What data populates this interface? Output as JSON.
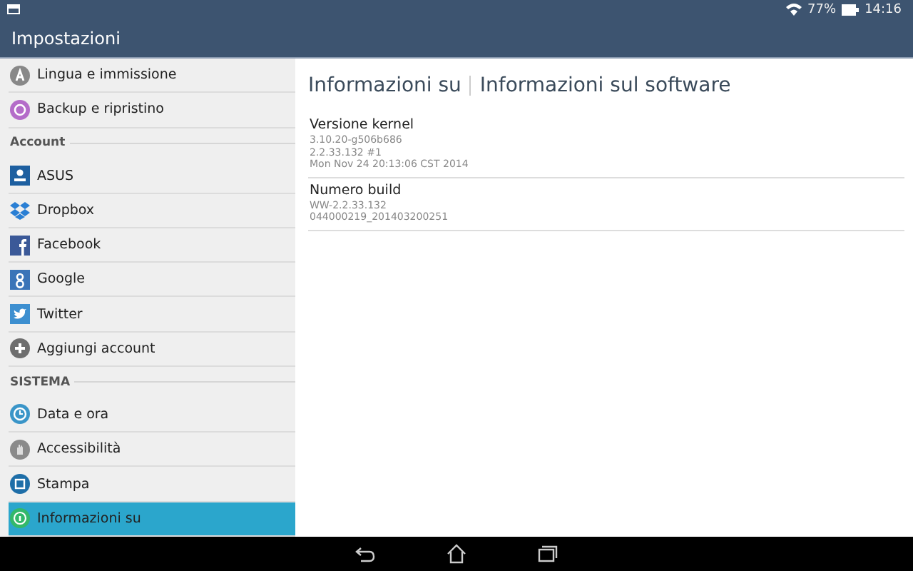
{
  "status_bar": {
    "battery": "77%",
    "time": "14:16"
  },
  "action_bar": {
    "title": "Impostazioni"
  },
  "sidebar": {
    "items": [
      {
        "kind": "item",
        "label": "Lingua e immissione",
        "selected": false
      },
      {
        "kind": "item",
        "label": "Backup e ripristino",
        "selected": false
      },
      {
        "kind": "header",
        "label": "Account"
      },
      {
        "kind": "item",
        "label": "ASUS",
        "selected": false
      },
      {
        "kind": "item",
        "label": "Dropbox",
        "selected": false
      },
      {
        "kind": "item",
        "label": "Facebook",
        "selected": false
      },
      {
        "kind": "item",
        "label": "Google",
        "selected": false
      },
      {
        "kind": "item",
        "label": "Twitter",
        "selected": false
      },
      {
        "kind": "item",
        "label": "Aggiungi account",
        "selected": false
      },
      {
        "kind": "header",
        "label": "SISTEMA"
      },
      {
        "kind": "item",
        "label": "Data e ora",
        "selected": false
      },
      {
        "kind": "item",
        "label": "Accessibilità",
        "selected": false
      },
      {
        "kind": "item",
        "label": "Stampa",
        "selected": false
      },
      {
        "kind": "item",
        "label": "Informazioni su",
        "selected": true
      }
    ]
  },
  "content": {
    "breadcrumb": [
      "Informazioni su",
      "Informazioni sul software"
    ],
    "entries": [
      {
        "title": "Versione kernel",
        "lines": [
          "3.10.20-g506b686",
          "2.2.33.132 #1",
          "Mon Nov 24 20:13:06 CST 2014"
        ]
      },
      {
        "title": "Numero build",
        "lines": [
          "WW-2.2.33.132",
          "044000219_201403200251"
        ]
      }
    ]
  }
}
